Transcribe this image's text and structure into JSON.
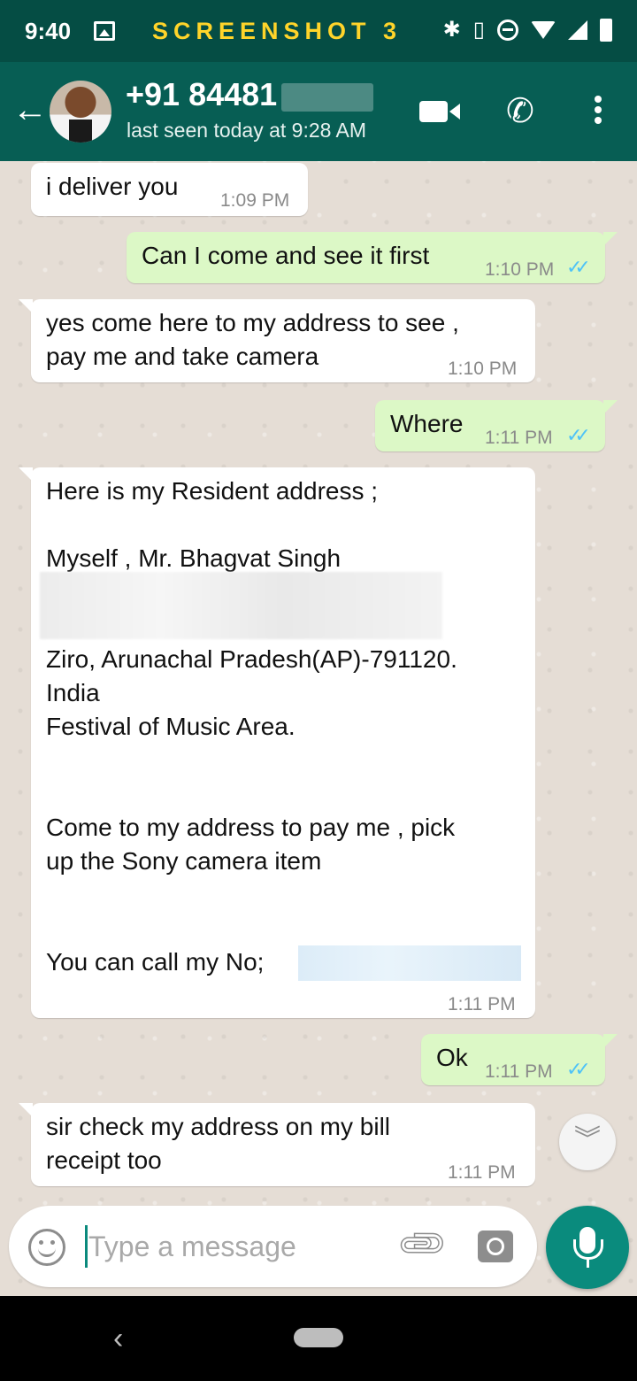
{
  "status_bar": {
    "time": "9:40",
    "overlay_label": "SCREENSHOT 3"
  },
  "header": {
    "contact_name": "+91 84481",
    "status": "last seen today at 9:28 AM"
  },
  "messages": [
    {
      "dir": "in",
      "text": "i deliver you",
      "time": "1:09 PM"
    },
    {
      "dir": "out",
      "text": "Can I come and see it first",
      "time": "1:10 PM",
      "read": true
    },
    {
      "dir": "in",
      "text": "yes come here to my address to see ,\npay me and take camera",
      "time": "1:10 PM"
    },
    {
      "dir": "out",
      "text": "Where",
      "time": "1:11 PM",
      "read": true
    },
    {
      "dir": "in",
      "time": "1:11 PM",
      "lines": {
        "l1": "Here is my Resident address ;",
        "l2": "Myself , Mr. Bhagvat Singh",
        "l3": "Ziro, Arunachal Pradesh(AP)-791120.",
        "l4": "India",
        "l5": "Festival of Music Area.",
        "l6": "Come to my address to pay me , pick",
        "l7": "up the Sony camera  item",
        "l8": "You can call my No;"
      }
    },
    {
      "dir": "out",
      "text": "Ok",
      "time": "1:11 PM",
      "read": true
    },
    {
      "dir": "in",
      "text": "sir check my address on my bill\nreceipt too",
      "time": "1:11 PM"
    }
  ],
  "input": {
    "placeholder": "Type a message"
  },
  "colors": {
    "header": "#075e54",
    "status_bar": "#054d44",
    "outgoing_bubble": "#dcf8c6",
    "incoming_bubble": "#ffffff",
    "read_ticks": "#4fc3f7",
    "mic_button": "#0a8b7d",
    "chat_background": "#e5ddd5"
  },
  "icons": {
    "back": "arrow-left-icon",
    "video_call": "video-camera-icon",
    "voice_call": "phone-icon",
    "menu": "more-vert-icon",
    "scroll": "double-chevron-down-icon",
    "emoji": "emoji-icon",
    "attach": "paperclip-icon",
    "camera": "camera-icon",
    "mic": "mic-icon"
  }
}
